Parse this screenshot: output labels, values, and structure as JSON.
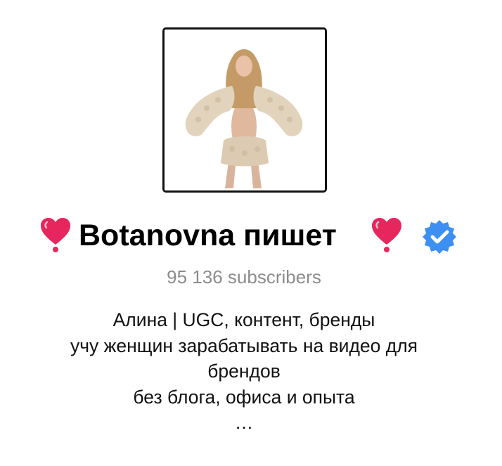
{
  "channel": {
    "title": "Botanovna пишет",
    "subscribers": "95 136 subscribers",
    "verified": true,
    "avatar_alt": "channel avatar photo"
  },
  "description": {
    "lines": [
      "Алина | UGC, контент, бренды",
      "учу женщин зарабатывать на видео для",
      "брендов",
      "без блога, офиса и опыта",
      "…"
    ]
  },
  "icons": {
    "heart": "heart-exclamation-icon",
    "verified": "verified-badge-icon"
  },
  "colors": {
    "heart": "#e8265e",
    "verified": "#3d8ff2",
    "subscribers_text": "#8c8c8c",
    "title_text": "#000000"
  }
}
